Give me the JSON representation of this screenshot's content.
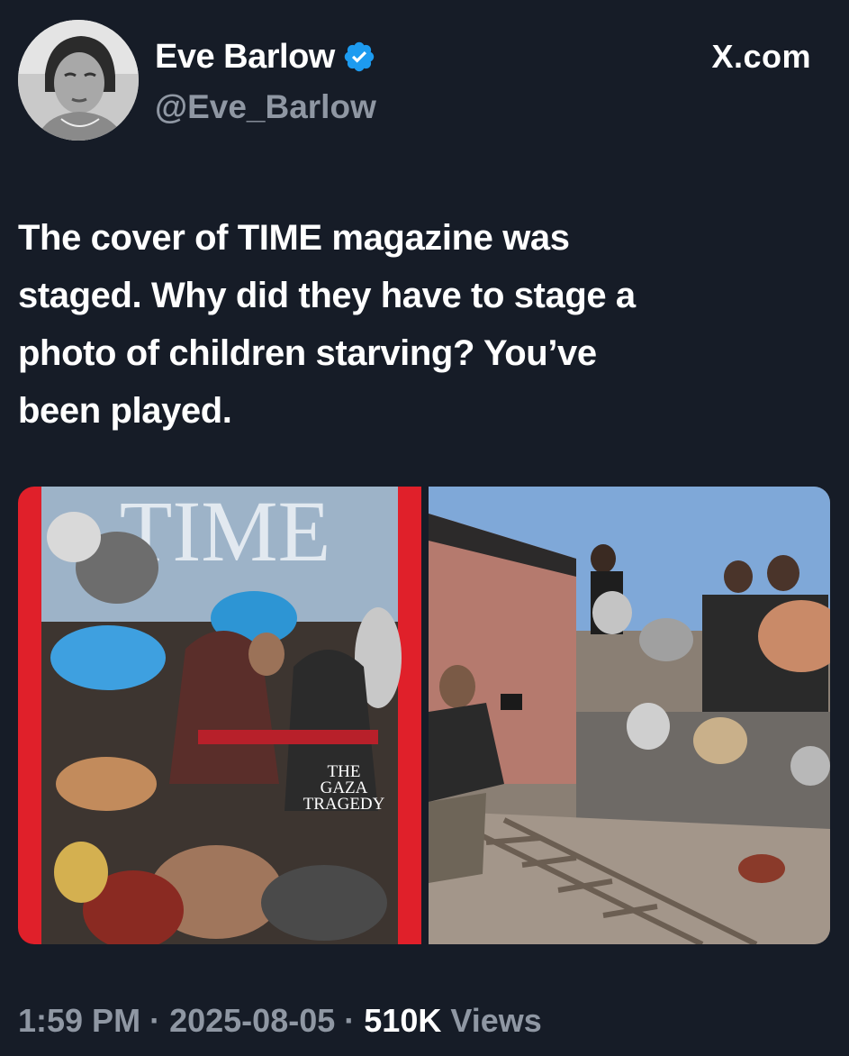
{
  "post": {
    "author": {
      "display_name": "Eve Barlow",
      "handle": "@Eve_Barlow",
      "verified": true,
      "avatar_icon": "profile-photo"
    },
    "site_label": "X.com",
    "text_lines": [
      "The cover of TIME magazine was",
      "staged. Why did they have to stage a",
      "photo of children starving? You’ve",
      "been played."
    ],
    "media": {
      "left_image": {
        "masthead": "TIME",
        "cover_headline_lines": [
          "THE",
          "GAZA",
          "TRAGEDY"
        ]
      },
      "right_image": {
        "icon": "photo-of-photographer-and-crowd"
      }
    },
    "meta": {
      "time": "1:59 PM",
      "separator": "·",
      "date": "2025-08-05",
      "views_count": "510K",
      "views_label": "Views"
    }
  },
  "colors": {
    "background": "#161c27",
    "text_primary": "#ffffff",
    "text_secondary": "#8f97a3",
    "verified_blue": "#1d9bf0",
    "time_red": "#e0202a"
  }
}
